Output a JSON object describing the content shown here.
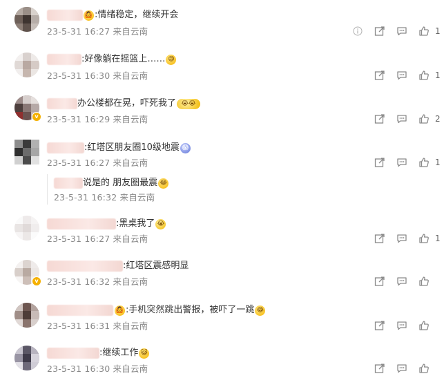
{
  "comments": [
    {
      "text": ":情绪稳定，继续开会",
      "emoji_before": "🙆",
      "emoji_after": "",
      "meta": "23-5-31 16:27 来自云南",
      "likes": "1",
      "has_info": true
    },
    {
      "text": ":好像躺在摇篮上……",
      "emoji_before": "",
      "emoji_after": "😅",
      "meta": "23-5-31 16:30 来自云南",
      "likes": "1"
    },
    {
      "text": "办公楼都在晃，吓死我了",
      "emoji_before": "",
      "emoji_after": "😭😭",
      "meta": "23-5-31 16:29 来自云南",
      "likes": "2"
    },
    {
      "text": ":红塔区朋友圈10级地震",
      "emoji_before": "",
      "emoji_after": "😱",
      "meta": "23-5-31 16:27 来自云南",
      "likes": "1",
      "reply": {
        "text": "说是的  朋友圈最震",
        "emoji_after": "😂",
        "meta": "23-5-31 16:32 来自云南"
      }
    },
    {
      "text": ":黑桌我了",
      "emoji_before": "",
      "emoji_after": "😭",
      "meta": "23-5-31 16:27 来自云南",
      "likes": "1"
    },
    {
      "text": ":红塔区震感明显",
      "emoji_before": "",
      "emoji_after": "",
      "meta": "23-5-31 16:32 来自云南",
      "likes": ""
    },
    {
      "text": ":手机突然跳出警报，被吓了一跳",
      "emoji_before": "🙆",
      "emoji_after": "😂",
      "meta": "23-5-31 16:31 来自云南",
      "likes": ""
    },
    {
      "text": ":继续工作",
      "emoji_before": "",
      "emoji_after": "😺",
      "meta": "23-5-31 16:30 来自云南",
      "likes": ""
    }
  ],
  "icons": {
    "info": "info-icon",
    "forward": "forward-icon",
    "comment": "comment-icon",
    "like": "thumbs-up-icon"
  },
  "colors": {
    "meta": "#888888",
    "icon": "#8a8a8a",
    "masked_name": "#f6d9d4"
  }
}
